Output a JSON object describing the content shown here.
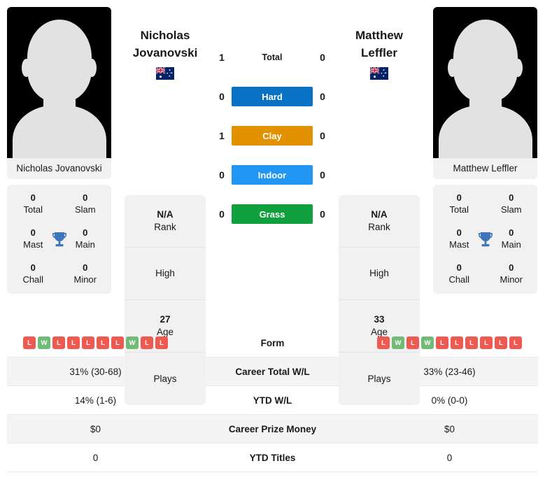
{
  "players": {
    "left": {
      "name_line1": "Nicholas",
      "name_line2": "Jovanovski",
      "photo_caption": "Nicholas Jovanovski",
      "flag": "australia-flag",
      "rank_value": "N/A",
      "rank_label": "Rank",
      "high_value": "",
      "high_label": "High",
      "age_value": "27",
      "age_label": "Age",
      "plays_value": "",
      "plays_label": "Plays",
      "titles": {
        "total_value": "0",
        "total_label": "Total",
        "slam_value": "0",
        "slam_label": "Slam",
        "mast_value": "0",
        "mast_label": "Mast",
        "main_value": "0",
        "main_label": "Main",
        "chall_value": "0",
        "chall_label": "Chall",
        "minor_value": "0",
        "minor_label": "Minor"
      },
      "form": [
        "L",
        "W",
        "L",
        "L",
        "L",
        "L",
        "L",
        "W",
        "L",
        "L"
      ],
      "career_total_wl": "31% (30-68)",
      "ytd_wl": "14% (1-6)",
      "career_prize_money": "$0",
      "ytd_titles": "0"
    },
    "right": {
      "name_line1": "Matthew",
      "name_line2": "Leffler",
      "photo_caption": "Matthew Leffler",
      "flag": "australia-flag",
      "rank_value": "N/A",
      "rank_label": "Rank",
      "high_value": "",
      "high_label": "High",
      "age_value": "33",
      "age_label": "Age",
      "plays_value": "",
      "plays_label": "Plays",
      "titles": {
        "total_value": "0",
        "total_label": "Total",
        "slam_value": "0",
        "slam_label": "Slam",
        "mast_value": "0",
        "mast_label": "Mast",
        "main_value": "0",
        "main_label": "Main",
        "chall_value": "0",
        "chall_label": "Chall",
        "minor_value": "0",
        "minor_label": "Minor"
      },
      "form": [
        "L",
        "W",
        "L",
        "W",
        "L",
        "L",
        "L",
        "L",
        "L",
        "L"
      ],
      "career_total_wl": "33% (23-46)",
      "ytd_wl": "0% (0-0)",
      "career_prize_money": "$0",
      "ytd_titles": "0"
    }
  },
  "head_to_head": [
    {
      "label": "Total",
      "left": "1",
      "right": "0",
      "color": "",
      "style": "plain"
    },
    {
      "label": "Hard",
      "left": "0",
      "right": "0",
      "color": "#0a72c4",
      "style": "bar"
    },
    {
      "label": "Clay",
      "left": "1",
      "right": "0",
      "color": "#e29100",
      "style": "bar"
    },
    {
      "label": "Indoor",
      "left": "0",
      "right": "0",
      "color": "#2196f3",
      "style": "bar"
    },
    {
      "label": "Grass",
      "left": "0",
      "right": "0",
      "color": "#10a13e",
      "style": "bar"
    }
  ],
  "stats_rows": [
    {
      "label": "Form",
      "type": "form"
    },
    {
      "label": "Career Total W/L",
      "type": "text",
      "key": "career_total_wl"
    },
    {
      "label": "YTD W/L",
      "type": "text",
      "key": "ytd_wl"
    },
    {
      "label": "Career Prize Money",
      "type": "text",
      "key": "career_prize_money"
    },
    {
      "label": "YTD Titles",
      "type": "text",
      "key": "ytd_titles"
    }
  ],
  "colors": {
    "hard": "#0a72c4",
    "clay": "#e29100",
    "indoor": "#2196f3",
    "grass": "#10a13e",
    "win_badge": "#72bb77",
    "loss_badge": "#ee5a52",
    "trophy": "#3e76bb",
    "panel": "#f1f1f1"
  }
}
